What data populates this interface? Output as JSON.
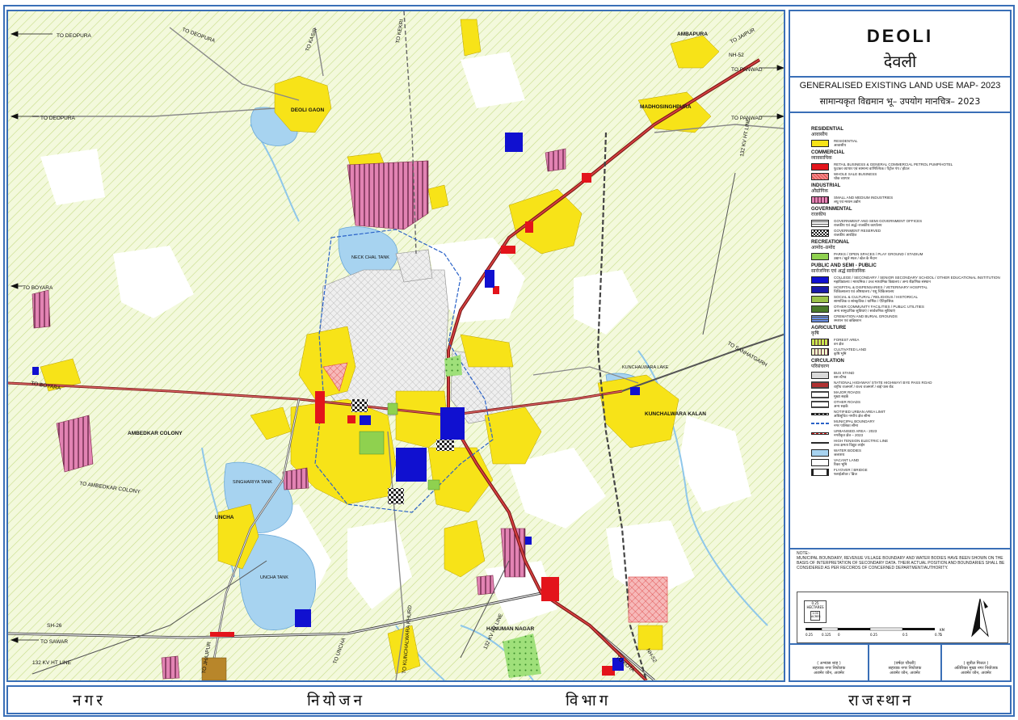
{
  "title": {
    "en": "DEOLI",
    "hi": "देवली"
  },
  "subtitle": {
    "en": "GENERALISED EXISTING LAND USE MAP- 2023",
    "hi": "सामान्यकृत विद्यमान भू– उपयोग मानचित्र– 2023"
  },
  "map_labels": {
    "to_deopura_1": "TO DEOPURA",
    "to_deopura_2": "TO DEOPURA",
    "to_deopura_3": "TO DEOPURA",
    "to_kasir": "TO KASIR",
    "to_kekri": "TO KEKRI",
    "to_jaipur": "TO JAIPUR",
    "nh52": "NH-52",
    "ambapura": "AMBAPURA",
    "to_panwad_1": "TO PANWAD",
    "to_panwad_2": "TO PANWAD",
    "deoli_gaon": "DEOLI GAON",
    "madhosinghpura": "MADHOSINGHPURA",
    "to_boyara_1": "TO BOYARA",
    "to_boyara_2": "TO BOYARA",
    "neck_chal_tank": "NECK CHAL TANK",
    "kv132_line_1": "132 KV HT LINE",
    "kv132_line_2": "132 KV HT LINE",
    "kv132_line_3": "132 KV HT LINE",
    "to_sanhatgarh": "TO SANHATGARH",
    "kunchalwara_lake": "KUNCHALWARA LAKE",
    "kunchalwara_kalan": "KUNCHALWARA KALAN",
    "ambedkar_colony": "AMBEDKAR COLONY",
    "to_ambedkar_colony": "TO AMBEDKAR COLONY",
    "singhariya_tank": "SINGHARIYA TANK",
    "uncha": "UNCHA",
    "uncha_tank": "UNCHA TANK",
    "sh26": "SH-26",
    "to_sawar": "TO SAWAR",
    "to_jahazpur": "TO JHAJPUR",
    "to_uncha": "TO UNCHA",
    "to_kunchalwara": "TO KUNCHALWARA KHURD",
    "hanuman_nagar": "HANUMAN NAGAR",
    "to_kota": "TO KOTA",
    "nh52_south": "NH-52"
  },
  "legend": [
    {
      "head": "RESIDENTIAL",
      "head_hi": "आवासीय",
      "items": [
        {
          "color": "#f7e318",
          "pattern": "solid",
          "text": "RESIDENTIAL",
          "text_hi": "आवासीय"
        }
      ]
    },
    {
      "head": "COMMERCIAL",
      "head_hi": "व्यावसायिक",
      "items": [
        {
          "color": "#e3141b",
          "pattern": "solid",
          "text": "RETAIL BUSINESS & GENERAL COMMERCIAL PETROL PUMP/HOTEL",
          "text_hi": "फुटकर व्यापार एवं सामान्य वाणिज्यिक / पैट्रोल पंप / होटल"
        },
        {
          "color": "#f28a8a",
          "pattern": "cross",
          "text": "WHOLE SALE BUSINESS",
          "text_hi": "थोक व्यापार"
        }
      ]
    },
    {
      "head": "INDUSTRIAL",
      "head_hi": "औद्योगिक",
      "items": [
        {
          "color": "#e283b3",
          "pattern": "stripe",
          "text": "SMALL AND MEDIUM INDUSTRIES",
          "text_hi": "लघु एवं मध्यम उद्योग"
        }
      ]
    },
    {
      "head": "GOVERNMENTAL",
      "head_hi": "राजकीय",
      "items": [
        {
          "color": "#ffffff",
          "pattern": "grid",
          "text": "GOVERNMENT AND SEMI GOVERNMENT OFFICES",
          "text_hi": "राजकीय एवं अर्द्ध–राजकीय कार्यालय"
        },
        {
          "color": "#888888",
          "pattern": "check",
          "text": "GOVERNMENT RESERVED",
          "text_hi": "राजकीय आरक्षित"
        }
      ]
    },
    {
      "head": "RECREATIONAL",
      "head_hi": "आमोद–प्रमोद",
      "items": [
        {
          "color": "#8fd14f",
          "pattern": "solid",
          "text": "PARKS / OPEN SPACES / PLAY GROUND / STADIUM",
          "text_hi": "उद्यान / खुले स्थल / खेल के मैदान"
        }
      ]
    },
    {
      "head": "PUBLIC AND SEMI - PUBLIC",
      "head_hi": "सार्वजनिक एवं अर्द्ध सार्वजनिक",
      "items": [
        {
          "color": "#1010d0",
          "pattern": "solid",
          "text": "COLLEGE / SECONDARY / SENIOR SECONDARY SCHOOL / OTHER EDUCATIONAL INSTITUTION",
          "text_hi": "महाविद्यालय / माध्यमिक / उच्च माध्यमिक विद्यालय / अन्य शैक्षणिक संस्थान"
        },
        {
          "color": "#1a1aa8",
          "pattern": "solid",
          "text": "HOSPITAL & DISPENSARIES / VETERINARY HOSPITAL",
          "text_hi": "चिकित्सालय एवं औषधालय / पशु चिकित्सालय"
        },
        {
          "color": "#9bc24a",
          "pattern": "solid",
          "text": "SOCIAL & CULTURAL / RELIGIOUS / HISTORICAL",
          "text_hi": "सामाजिक व सांस्कृतिक / धार्मिक / ऐतिहासिक"
        },
        {
          "color": "#4a7a2a",
          "pattern": "solid",
          "text": "OTHER COMMUNITY FACILITIES / PUBLIC UTILITIES",
          "text_hi": "अन्य सामुदायिक सुविधाएं / सार्वजनिक सुविधाएं"
        },
        {
          "color": "#6a8ee0",
          "pattern": "grid",
          "text": "CREMATION AND BURIAL GROUNDS",
          "text_hi": "श्मशान एवं कब्रिस्तान"
        }
      ]
    },
    {
      "head": "AGRICULTURE",
      "head_hi": "कृषि",
      "items": [
        {
          "color": "#c8e650",
          "pattern": "stripe",
          "text": "FOREST AREA",
          "text_hi": "वन क्षेत्र"
        },
        {
          "color": "#eef5c8",
          "pattern": "stripe",
          "text": "CULTIVATED LAND",
          "text_hi": "कृषि भूमि"
        }
      ]
    },
    {
      "head": "CIRCULATION",
      "head_hi": "परिसंचरण",
      "items": [
        {
          "color": "#d9d9d9",
          "pattern": "solid",
          "text": "BUS STAND",
          "text_hi": "बस स्टैण्ड"
        },
        {
          "color": "#b03030",
          "pattern": "road",
          "text": "NATIONAL HIGHWAY/ STATE HIGHWAY/ BYE PASS ROAD",
          "text_hi": "राष्ट्रीय राजमार्ग / राज्य राजमार्ग / बाई पास रोड"
        },
        {
          "color": "#ffffff",
          "pattern": "road",
          "text": "MAJOR ROADS",
          "text_hi": "मुख्य सड़कें"
        },
        {
          "color": "#ffffff",
          "pattern": "road",
          "text": "OTHER ROADS",
          "text_hi": "अन्य सड़कें"
        },
        {
          "color": "#ffffff",
          "pattern": "rail",
          "text": "NOTIFIED URBAN AREA LIMIT",
          "text_hi": "अधिसूचित नगरीय क्षेत्र सीमा"
        },
        {
          "color": "#ffffff",
          "pattern": "blueline",
          "text": "MUNICIPAL BOUNDARY",
          "text_hi": "नगर पालिका सीमा"
        },
        {
          "color": "#ffffff",
          "pattern": "redline",
          "text": "URBANISED AREA - 2023",
          "text_hi": "नगरीकृत क्षेत्र – 2023"
        },
        {
          "color": "#ffffff",
          "pattern": "htline",
          "text": "HIGH TENSION ELECTRIC LINE",
          "text_hi": "उच्च क्षमता विद्युत लाईन"
        },
        {
          "color": "#a7d3f0",
          "pattern": "solid",
          "text": "WATER BODIES",
          "text_hi": "जलाशय"
        },
        {
          "color": "#ffffff",
          "pattern": "solid",
          "text": "VACANT LAND",
          "text_hi": "रिक्त भूमि"
        },
        {
          "color": "#ffffff",
          "pattern": "flyover",
          "text": "FLYOVER / BRIDGE",
          "text_hi": "फ्लाईओवर / ब्रिज"
        }
      ]
    }
  ],
  "note": {
    "title": "NOTE:-",
    "text": "MUNICIPAL BOUNDARY, REVENUE VILLAGE BOUNDARY AND WATER BODIES HAVE BEEN SHOWN ON THE BASIS OF INTERPRETATION OF SECONDARY DATA. THEIR ACTUAL POSITION AND BOUNDARIES SHALL BE CONSIDERED AS PER RECORDS OF CONCERNED DEPARTMENT/AUTHORITY."
  },
  "scale": {
    "box1": "0.25 HECTARES",
    "box2": "1.00 ACRES",
    "ticks": [
      "0.25",
      "0.125",
      "0",
      "0.25",
      "0.5",
      "0.75",
      "1"
    ],
    "unit": "KM"
  },
  "signatures": [
    {
      "name": "( अभ्यास शाह )",
      "role": "सहायक नगर नियोजक",
      "office": "अजमेर जोन, अजमेर"
    },
    {
      "name": "(वर्षदर चौधरी)",
      "role": "सहायक नगर नियोजक",
      "office": "अजमेर जोन, अजमेर"
    },
    {
      "name": "( सुनील मित्तल )",
      "role": "अतिरिक्त मुख्य नगर नियोजक",
      "office": "अजमेर जोन, अजमेर"
    }
  ],
  "footer": [
    "नगर",
    "नियोजन",
    "विभाग",
    "राजस्थान"
  ]
}
